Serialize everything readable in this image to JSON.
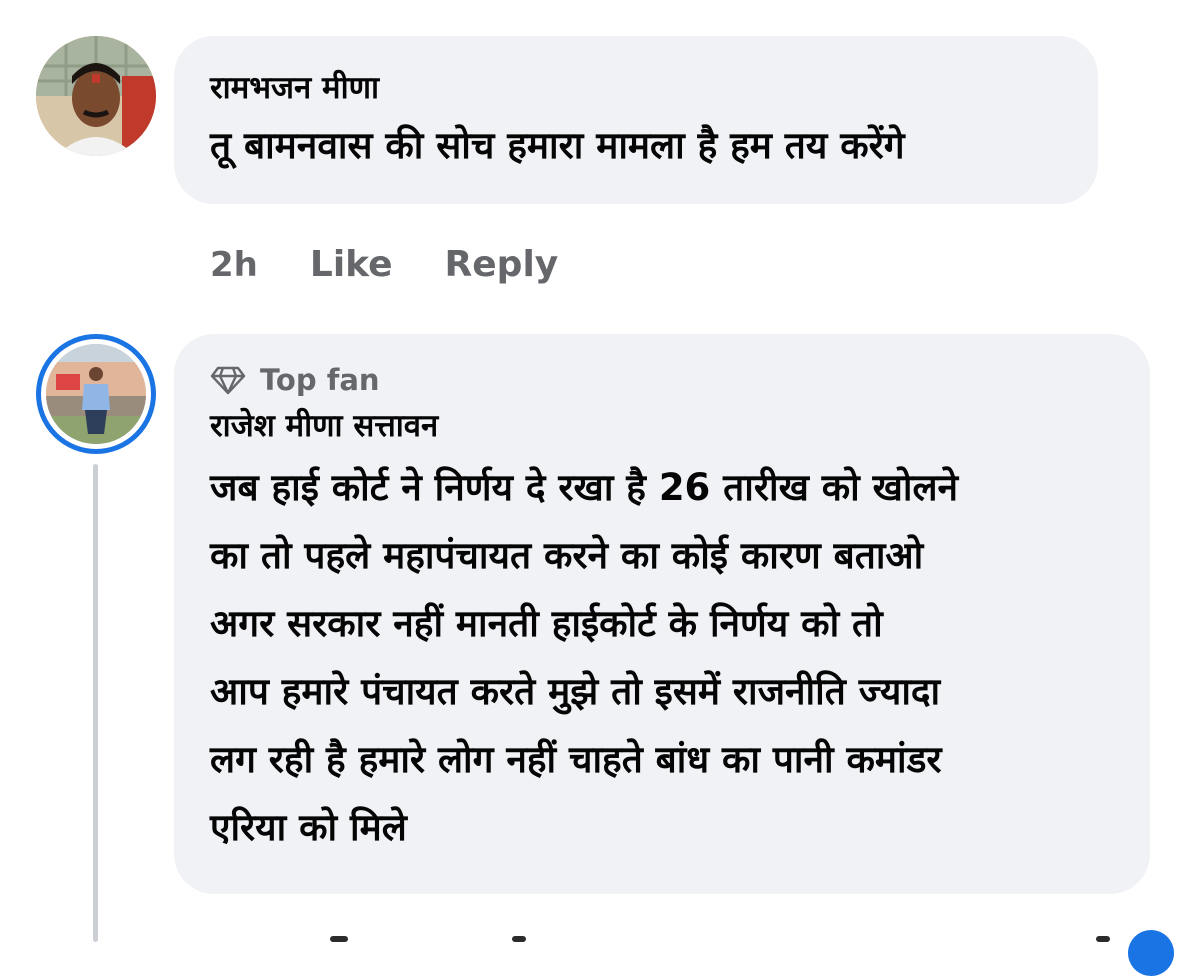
{
  "comments": [
    {
      "author": "रामभजन मीणा",
      "text_lines": [
        "तू बामनवास की सोच हमारा मामला है हम तय करेंगे"
      ],
      "time": "2h",
      "like_label": "Like",
      "reply_label": "Reply"
    },
    {
      "badge": "Top fan",
      "author": "राजेश मीणा सत्तावन",
      "text_lines": [
        "जब हाई कोर्ट ने निर्णय दे रखा है 26 तारीख को खोलने",
        "का तो पहले महापंचायत करने का कोई कारण बताओ",
        "अगर सरकार नहीं मानती हाईकोर्ट के निर्णय को तो",
        "आप हमारे पंचायत करते मुझे तो इसमें राजनीति ज्यादा",
        "लग रही है हमारे लोग नहीं चाहते बांध का पानी कमांडर",
        "एरिया को मिले"
      ]
    }
  ],
  "icons": {
    "badge_icon": "diamond-icon"
  },
  "colors": {
    "bubble": "#f0f2f5",
    "meta_text": "#65676b",
    "top_fan_ring": "#1b74e4",
    "thread_line": "#ccd0d5"
  }
}
